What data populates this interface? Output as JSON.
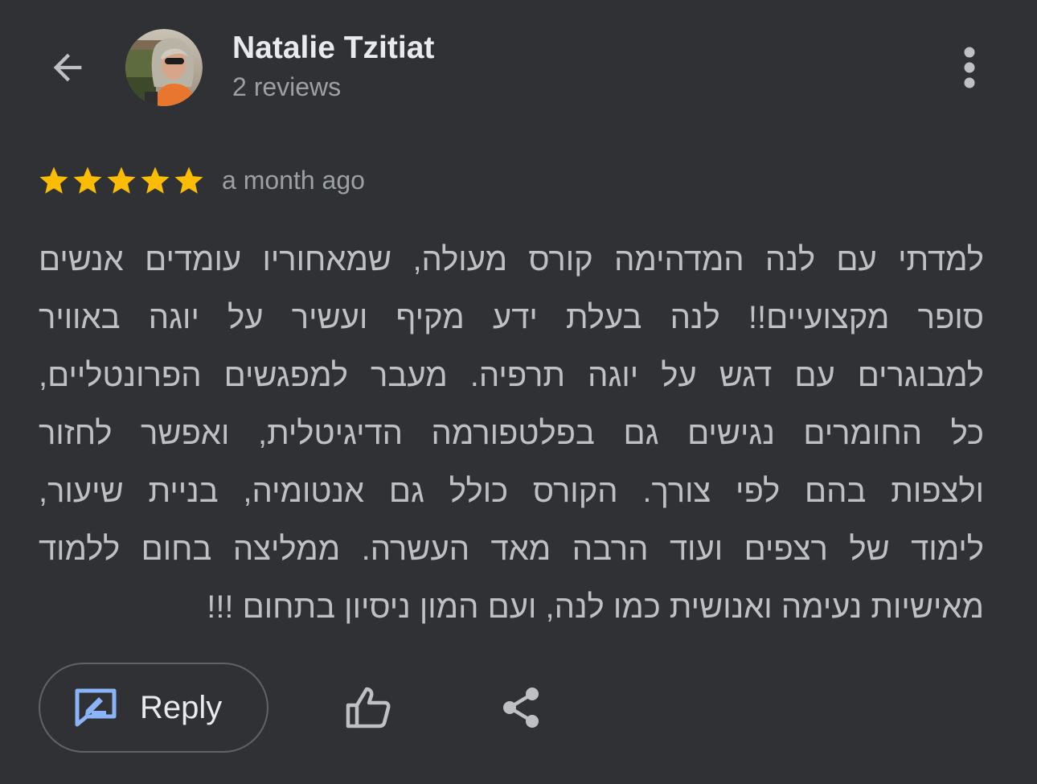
{
  "colors": {
    "background": "#303134",
    "primary_text": "#e8eaed",
    "secondary_text": "#9aa0a6",
    "body_text": "#bdc1c6",
    "star": "#fbbc04",
    "accent_blue": "#8ab4f8",
    "icon_gray": "#bdc1c6",
    "outline": "#5f6368"
  },
  "header": {
    "back_icon": "arrow-left-icon",
    "author": {
      "name": "Natalie Tzitiat",
      "review_count": "2 reviews",
      "avatar_icon": "user-photo-avatar"
    },
    "more_icon": "more-vert-icon"
  },
  "review": {
    "rating": 5,
    "max_rating": 5,
    "time_ago": "a month ago",
    "text_lines": [
      "למדתי עם לנה המדהימה קורס מעולה, שמאחוריו עומדים אנשים",
      "סופר מקצועיים!! לנה בעלת ידע מקיף ועשיר על יוגה באוויר",
      "למבוגרים עם דגש על יוגה תרפיה. מעבר למפגשים הפרונטליים,",
      "כל החומרים נגישים גם בפלטפורמה הדיגיטלית, ואפשר לחזור",
      "ולצפות בהם לפי צורך. הקורס כולל גם אנטומיה, בניית שיעור,",
      "לימוד של רצפים ועוד הרבה מאד העשרה. ממליצה בחום ללמוד",
      "מאישיות נעימה ואנושית כמו לנה, ועם המון ניסיון בתחום !!!"
    ]
  },
  "actions": {
    "reply": {
      "label": "Reply",
      "icon": "reply-edit-icon"
    },
    "like_icon": "thumb-up-icon",
    "share_icon": "share-icon"
  }
}
